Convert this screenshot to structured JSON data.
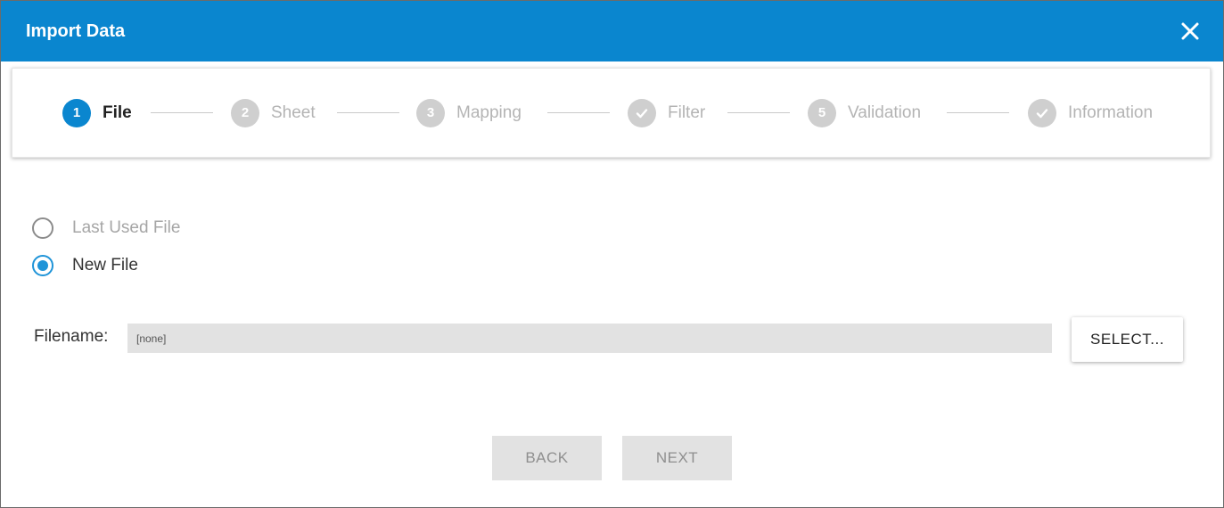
{
  "dialog": {
    "title": "Import Data",
    "close_icon": "close-icon"
  },
  "stepper": {
    "steps": [
      {
        "marker": "1",
        "label": "File",
        "state": "active",
        "icon": "number"
      },
      {
        "marker": "2",
        "label": "Sheet",
        "state": "inactive",
        "icon": "number"
      },
      {
        "marker": "3",
        "label": "Mapping",
        "state": "inactive",
        "icon": "number"
      },
      {
        "marker": "",
        "label": "Filter",
        "state": "done",
        "icon": "check-icon"
      },
      {
        "marker": "5",
        "label": "Validation",
        "state": "inactive",
        "icon": "number"
      },
      {
        "marker": "",
        "label": "Information",
        "state": "done",
        "icon": "check-icon"
      }
    ]
  },
  "file_source": {
    "options": [
      {
        "label": "Last Used File",
        "checked": false,
        "enabled": false
      },
      {
        "label": "New File",
        "checked": true,
        "enabled": true
      }
    ]
  },
  "filename": {
    "label": "Filename:",
    "value": "[none]"
  },
  "buttons": {
    "select": "SELECT...",
    "back": "BACK",
    "next": "NEXT"
  },
  "colors": {
    "accent": "#0a86cf",
    "radio_accent": "#1f94d8",
    "inactive_step": "#cfcfcf"
  }
}
